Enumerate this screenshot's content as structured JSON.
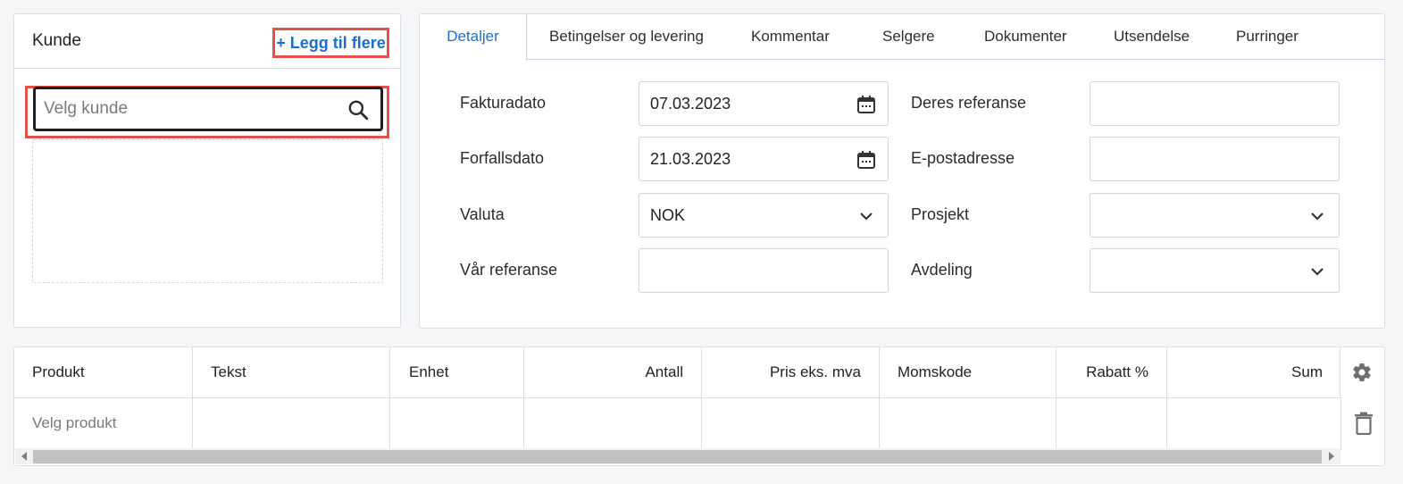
{
  "customer": {
    "title": "Kunde",
    "add_more_label": "+ Legg til flere",
    "search_placeholder": "Velg kunde"
  },
  "tabs": [
    {
      "label": "Detaljer",
      "active": true
    },
    {
      "label": "Betingelser og levering"
    },
    {
      "label": "Kommentar"
    },
    {
      "label": "Selgere"
    },
    {
      "label": "Dokumenter"
    },
    {
      "label": "Utsendelse"
    },
    {
      "label": "Purringer"
    }
  ],
  "form": {
    "invoice_date": {
      "label": "Fakturadato",
      "value": "07.03.2023"
    },
    "due_date": {
      "label": "Forfallsdato",
      "value": "21.03.2023"
    },
    "currency": {
      "label": "Valuta",
      "value": "NOK"
    },
    "our_reference": {
      "label": "Vår referanse",
      "value": ""
    },
    "your_reference": {
      "label": "Deres referanse",
      "value": ""
    },
    "email": {
      "label": "E-postadresse",
      "value": ""
    },
    "project": {
      "label": "Prosjekt",
      "value": ""
    },
    "department": {
      "label": "Avdeling",
      "value": ""
    }
  },
  "table": {
    "columns": [
      "Produkt",
      "Tekst",
      "Enhet",
      "Antall",
      "Pris eks. mva",
      "Momskode",
      "Rabatt %",
      "Sum"
    ],
    "row_placeholder": "Velg produkt"
  },
  "icons": {
    "search": "search-icon",
    "calendar": "calendar-icon",
    "dropdown": "chevron-down-icon",
    "settings": "gear-icon",
    "delete": "trash-icon"
  },
  "colors": {
    "accent": "#1a6fd1",
    "highlight": "#e0524a"
  }
}
